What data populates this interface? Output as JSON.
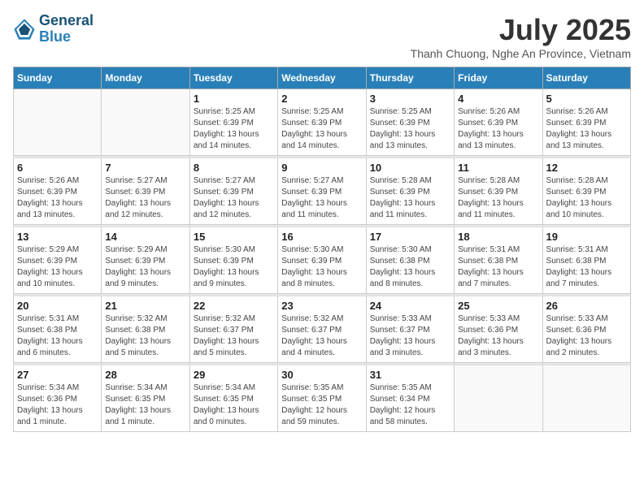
{
  "header": {
    "logo_line1": "General",
    "logo_line2": "Blue",
    "month_title": "July 2025",
    "subtitle": "Thanh Chuong, Nghe An Province, Vietnam"
  },
  "days_of_week": [
    "Sunday",
    "Monday",
    "Tuesday",
    "Wednesday",
    "Thursday",
    "Friday",
    "Saturday"
  ],
  "weeks": [
    [
      {
        "day": "",
        "info": ""
      },
      {
        "day": "",
        "info": ""
      },
      {
        "day": "1",
        "info": "Sunrise: 5:25 AM\nSunset: 6:39 PM\nDaylight: 13 hours\nand 14 minutes."
      },
      {
        "day": "2",
        "info": "Sunrise: 5:25 AM\nSunset: 6:39 PM\nDaylight: 13 hours\nand 14 minutes."
      },
      {
        "day": "3",
        "info": "Sunrise: 5:25 AM\nSunset: 6:39 PM\nDaylight: 13 hours\nand 13 minutes."
      },
      {
        "day": "4",
        "info": "Sunrise: 5:26 AM\nSunset: 6:39 PM\nDaylight: 13 hours\nand 13 minutes."
      },
      {
        "day": "5",
        "info": "Sunrise: 5:26 AM\nSunset: 6:39 PM\nDaylight: 13 hours\nand 13 minutes."
      }
    ],
    [
      {
        "day": "6",
        "info": "Sunrise: 5:26 AM\nSunset: 6:39 PM\nDaylight: 13 hours\nand 13 minutes."
      },
      {
        "day": "7",
        "info": "Sunrise: 5:27 AM\nSunset: 6:39 PM\nDaylight: 13 hours\nand 12 minutes."
      },
      {
        "day": "8",
        "info": "Sunrise: 5:27 AM\nSunset: 6:39 PM\nDaylight: 13 hours\nand 12 minutes."
      },
      {
        "day": "9",
        "info": "Sunrise: 5:27 AM\nSunset: 6:39 PM\nDaylight: 13 hours\nand 11 minutes."
      },
      {
        "day": "10",
        "info": "Sunrise: 5:28 AM\nSunset: 6:39 PM\nDaylight: 13 hours\nand 11 minutes."
      },
      {
        "day": "11",
        "info": "Sunrise: 5:28 AM\nSunset: 6:39 PM\nDaylight: 13 hours\nand 11 minutes."
      },
      {
        "day": "12",
        "info": "Sunrise: 5:28 AM\nSunset: 6:39 PM\nDaylight: 13 hours\nand 10 minutes."
      }
    ],
    [
      {
        "day": "13",
        "info": "Sunrise: 5:29 AM\nSunset: 6:39 PM\nDaylight: 13 hours\nand 10 minutes."
      },
      {
        "day": "14",
        "info": "Sunrise: 5:29 AM\nSunset: 6:39 PM\nDaylight: 13 hours\nand 9 minutes."
      },
      {
        "day": "15",
        "info": "Sunrise: 5:30 AM\nSunset: 6:39 PM\nDaylight: 13 hours\nand 9 minutes."
      },
      {
        "day": "16",
        "info": "Sunrise: 5:30 AM\nSunset: 6:39 PM\nDaylight: 13 hours\nand 8 minutes."
      },
      {
        "day": "17",
        "info": "Sunrise: 5:30 AM\nSunset: 6:38 PM\nDaylight: 13 hours\nand 8 minutes."
      },
      {
        "day": "18",
        "info": "Sunrise: 5:31 AM\nSunset: 6:38 PM\nDaylight: 13 hours\nand 7 minutes."
      },
      {
        "day": "19",
        "info": "Sunrise: 5:31 AM\nSunset: 6:38 PM\nDaylight: 13 hours\nand 7 minutes."
      }
    ],
    [
      {
        "day": "20",
        "info": "Sunrise: 5:31 AM\nSunset: 6:38 PM\nDaylight: 13 hours\nand 6 minutes."
      },
      {
        "day": "21",
        "info": "Sunrise: 5:32 AM\nSunset: 6:38 PM\nDaylight: 13 hours\nand 5 minutes."
      },
      {
        "day": "22",
        "info": "Sunrise: 5:32 AM\nSunset: 6:37 PM\nDaylight: 13 hours\nand 5 minutes."
      },
      {
        "day": "23",
        "info": "Sunrise: 5:32 AM\nSunset: 6:37 PM\nDaylight: 13 hours\nand 4 minutes."
      },
      {
        "day": "24",
        "info": "Sunrise: 5:33 AM\nSunset: 6:37 PM\nDaylight: 13 hours\nand 3 minutes."
      },
      {
        "day": "25",
        "info": "Sunrise: 5:33 AM\nSunset: 6:36 PM\nDaylight: 13 hours\nand 3 minutes."
      },
      {
        "day": "26",
        "info": "Sunrise: 5:33 AM\nSunset: 6:36 PM\nDaylight: 13 hours\nand 2 minutes."
      }
    ],
    [
      {
        "day": "27",
        "info": "Sunrise: 5:34 AM\nSunset: 6:36 PM\nDaylight: 13 hours\nand 1 minute."
      },
      {
        "day": "28",
        "info": "Sunrise: 5:34 AM\nSunset: 6:35 PM\nDaylight: 13 hours\nand 1 minute."
      },
      {
        "day": "29",
        "info": "Sunrise: 5:34 AM\nSunset: 6:35 PM\nDaylight: 13 hours\nand 0 minutes."
      },
      {
        "day": "30",
        "info": "Sunrise: 5:35 AM\nSunset: 6:35 PM\nDaylight: 12 hours\nand 59 minutes."
      },
      {
        "day": "31",
        "info": "Sunrise: 5:35 AM\nSunset: 6:34 PM\nDaylight: 12 hours\nand 58 minutes."
      },
      {
        "day": "",
        "info": ""
      },
      {
        "day": "",
        "info": ""
      }
    ]
  ]
}
